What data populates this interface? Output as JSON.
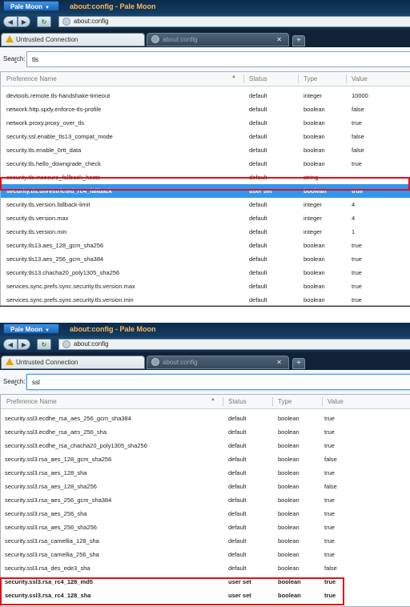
{
  "shots": [
    {
      "app_button": "Pale Moon",
      "window_title": "about:config - Pale Moon",
      "url": "about:config",
      "tabs": [
        {
          "label": "Untrusted Connection",
          "icon": "warning-icon"
        },
        {
          "label": "about:config",
          "icon": "globe-icon"
        }
      ],
      "search": {
        "label_prefix": "Sea",
        "label_accesskey": "r",
        "label_suffix": "ch:",
        "value": "tls"
      },
      "columns": {
        "name": "Preference Name",
        "status": "Status",
        "type": "Type",
        "value": "Value"
      },
      "rows": [
        {
          "name": "devtools.remote.tls-handshake-timeout",
          "status": "default",
          "type": "integer",
          "value": "10000"
        },
        {
          "name": "network.http.spdy.enforce-tls-profile",
          "status": "default",
          "type": "boolean",
          "value": "false"
        },
        {
          "name": "network.proxy.proxy_over_tls",
          "status": "default",
          "type": "boolean",
          "value": "true"
        },
        {
          "name": "security.ssl.enable_tls13_compat_mode",
          "status": "default",
          "type": "boolean",
          "value": "false"
        },
        {
          "name": "security.tls.enable_0rtt_data",
          "status": "default",
          "type": "boolean",
          "value": "false"
        },
        {
          "name": "security.tls.hello_downgrade_check",
          "status": "default",
          "type": "boolean",
          "value": "true"
        },
        {
          "name": "security.tls.insecure_fallback_hosts",
          "status": "default",
          "type": "string",
          "value": ""
        },
        {
          "name": "security.tls.unrestricted_rc4_fallback",
          "status": "user set",
          "type": "boolean",
          "value": "true"
        },
        {
          "name": "security.tls.version.fallback-limit",
          "status": "default",
          "type": "integer",
          "value": "4"
        },
        {
          "name": "security.tls.version.max",
          "status": "default",
          "type": "integer",
          "value": "4"
        },
        {
          "name": "security.tls.version.min",
          "status": "default",
          "type": "integer",
          "value": "1"
        },
        {
          "name": "security.tls13.aes_128_gcm_sha256",
          "status": "default",
          "type": "boolean",
          "value": "true"
        },
        {
          "name": "security.tls13.aes_256_gcm_sha384",
          "status": "default",
          "type": "boolean",
          "value": "true"
        },
        {
          "name": "security.tls13.chacha20_poly1305_sha256",
          "status": "default",
          "type": "boolean",
          "value": "true"
        },
        {
          "name": "services.sync.prefs.sync.security.tls.version.max",
          "status": "default",
          "type": "boolean",
          "value": "true"
        },
        {
          "name": "services.sync.prefs.sync.security.tls.version.min",
          "status": "default",
          "type": "boolean",
          "value": "true"
        }
      ]
    },
    {
      "app_button": "Pale Moon",
      "window_title": "about:config - Pale Moon",
      "url": "about:config",
      "tabs": [
        {
          "label": "Untrusted Connection",
          "icon": "warning-icon"
        },
        {
          "label": "about:config",
          "icon": "globe-icon"
        }
      ],
      "search": {
        "label_prefix": "Sea",
        "label_accesskey": "r",
        "label_suffix": "ch:",
        "value": "ssl"
      },
      "columns": {
        "name": "Preference Name",
        "status": "Status",
        "type": "Type",
        "value": "Value"
      },
      "rows": [
        {
          "name": "security.ssl3.ecdhe_rsa_aes_256_gcm_sha384",
          "status": "default",
          "type": "boolean",
          "value": "true"
        },
        {
          "name": "security.ssl3.ecdhe_rsa_aes_256_sha",
          "status": "default",
          "type": "boolean",
          "value": "true"
        },
        {
          "name": "security.ssl3.ecdhe_rsa_chacha20_poly1305_sha256",
          "status": "default",
          "type": "boolean",
          "value": "true"
        },
        {
          "name": "security.ssl3.rsa_aes_128_gcm_sha256",
          "status": "default",
          "type": "boolean",
          "value": "false"
        },
        {
          "name": "security.ssl3.rsa_aes_128_sha",
          "status": "default",
          "type": "boolean",
          "value": "true"
        },
        {
          "name": "security.ssl3.rsa_aes_128_sha256",
          "status": "default",
          "type": "boolean",
          "value": "false"
        },
        {
          "name": "security.ssl3.rsa_aes_256_gcm_sha384",
          "status": "default",
          "type": "boolean",
          "value": "true"
        },
        {
          "name": "security.ssl3.rsa_aes_256_sha",
          "status": "default",
          "type": "boolean",
          "value": "true"
        },
        {
          "name": "security.ssl3.rsa_aes_256_sha256",
          "status": "default",
          "type": "boolean",
          "value": "true"
        },
        {
          "name": "security.ssl3.rsa_camellia_128_sha",
          "status": "default",
          "type": "boolean",
          "value": "true"
        },
        {
          "name": "security.ssl3.rsa_camellia_256_sha",
          "status": "default",
          "type": "boolean",
          "value": "true"
        },
        {
          "name": "security.ssl3.rsa_des_ede3_sha",
          "status": "default",
          "type": "boolean",
          "value": "false"
        },
        {
          "name": "security.ssl3.rsa_rc4_128_md5",
          "status": "user set",
          "type": "boolean",
          "value": "true"
        },
        {
          "name": "security.ssl3.rsa_rc4_128_sha",
          "status": "user set",
          "type": "boolean",
          "value": "true"
        }
      ]
    }
  ],
  "colors": {
    "selection": "#3197ef",
    "highlight_box": "#e0101a",
    "title_text": "#ffb75a"
  }
}
